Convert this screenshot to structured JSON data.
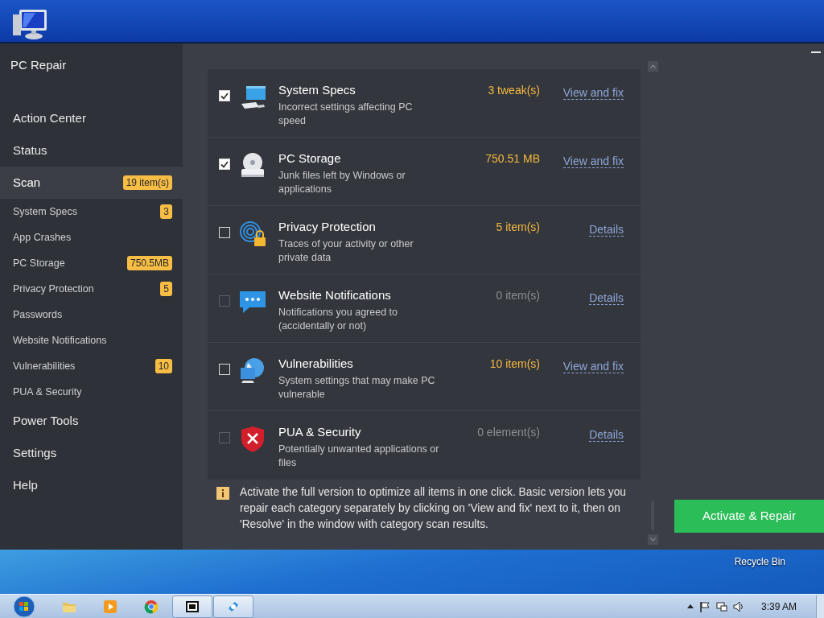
{
  "app": {
    "title": "PC Repair",
    "nav": [
      {
        "label": "Action Center",
        "selected": false
      },
      {
        "label": "Status",
        "selected": false
      },
      {
        "label": "Scan",
        "selected": true,
        "badge": "19 item(s)",
        "children": [
          {
            "label": "System Specs",
            "selected": false,
            "badge": "3"
          },
          {
            "label": "App Crashes",
            "selected": false
          },
          {
            "label": "PC Storage",
            "selected": false,
            "badge": "750.5MB"
          },
          {
            "label": "Privacy Protection",
            "selected": false,
            "badge": "5"
          },
          {
            "label": "Passwords",
            "selected": false
          },
          {
            "label": "Website Notifications",
            "selected": false
          },
          {
            "label": "Vulnerabilities",
            "selected": false,
            "badge": "10"
          },
          {
            "label": "PUA & Security",
            "selected": false
          }
        ]
      },
      {
        "label": "Power Tools",
        "selected": false
      },
      {
        "label": "Settings",
        "selected": false
      },
      {
        "label": "Help",
        "selected": false
      }
    ],
    "items": [
      {
        "title": "System Specs",
        "description": "Incorrect settings affecting PC speed",
        "value": "3 tweak(s)",
        "action": "View and fix",
        "checked": true,
        "disabled": false
      },
      {
        "title": "PC Storage",
        "description": "Junk files left by Windows or applications",
        "value": "750.51 MB",
        "action": "View and fix",
        "checked": true,
        "disabled": false
      },
      {
        "title": "Privacy Protection",
        "description": "Traces of your activity or other private data",
        "value": "5 item(s)",
        "action": "Details",
        "checked": false,
        "disabled": false
      },
      {
        "title": "Website Notifications",
        "description": "Notifications you agreed to (accidentally or not)",
        "value": "0 item(s)",
        "action": "Details",
        "checked": false,
        "disabled": true
      },
      {
        "title": "Vulnerabilities",
        "description": "System settings that may make PC vulnerable",
        "value": "10 item(s)",
        "action": "View and fix",
        "checked": false,
        "disabled": false
      },
      {
        "title": "PUA & Security",
        "description": "Potentially unwanted applications or files",
        "value": "0 element(s)",
        "action": "Details",
        "checked": false,
        "disabled": true
      }
    ],
    "notice": "Activate the full version to optimize all items in one click. Basic version lets you repair each category separately by clicking on 'View and fix' next to it, then on 'Resolve' in the window with category scan results.",
    "activate_button": "Activate & Repair"
  },
  "desktop": {
    "recycle_bin_label": "Recycle Bin"
  },
  "taskbar": {
    "apps": [
      {
        "kind": "folder",
        "active": false
      },
      {
        "kind": "media",
        "active": false
      },
      {
        "kind": "browser",
        "active": false
      },
      {
        "kind": "archiver",
        "active": true
      },
      {
        "kind": "repair",
        "active": true
      }
    ],
    "clock": "3:39 AM"
  }
}
